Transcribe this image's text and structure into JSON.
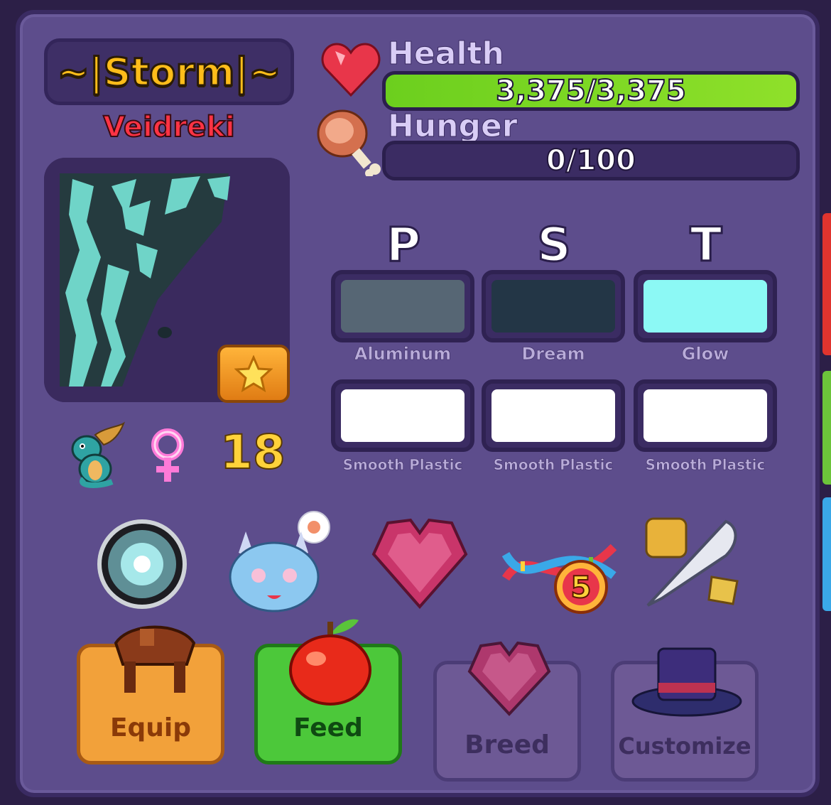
{
  "pet": {
    "name": "~|Storm|~",
    "species": "Veidreki",
    "level": "18",
    "gender_icon": "female-symbol-icon",
    "creature_icon": "dragon-icon"
  },
  "bars": {
    "health": {
      "label": "Health",
      "text": "3,375/3,375",
      "fill": 1.0,
      "color": "#8fe02a"
    },
    "hunger": {
      "label": "Hunger",
      "text": "0/100",
      "fill": 0.0,
      "color": "#8fe02a"
    }
  },
  "columns": [
    "P",
    "S",
    "T"
  ],
  "materials": {
    "row1": [
      {
        "name": "Aluminum",
        "color": "#566674"
      },
      {
        "name": "Dream",
        "color": "#233646"
      },
      {
        "name": "Glow",
        "color": "#8cf9f5"
      }
    ],
    "row2": [
      {
        "name": "Smooth Plastic",
        "color": "#ffffff"
      },
      {
        "name": "Smooth Plastic",
        "color": "#ffffff"
      },
      {
        "name": "Smooth Plastic",
        "color": "#ffffff"
      }
    ]
  },
  "trait_icons": [
    "orb-icon",
    "dragon-face-icon",
    "heart-gem-icon",
    "dna-icon",
    "quill-icon"
  ],
  "dna_badge": "5",
  "actions": {
    "equip": "Equip",
    "feed": "Feed",
    "breed": "Breed",
    "customize": "Customize"
  },
  "colors": {
    "panel": "#5d4d8c",
    "name": "#ffbd1a",
    "species": "#ff3344",
    "level": "#ffd23a",
    "equip": "#f2a13a",
    "feed": "#4cc83a"
  }
}
